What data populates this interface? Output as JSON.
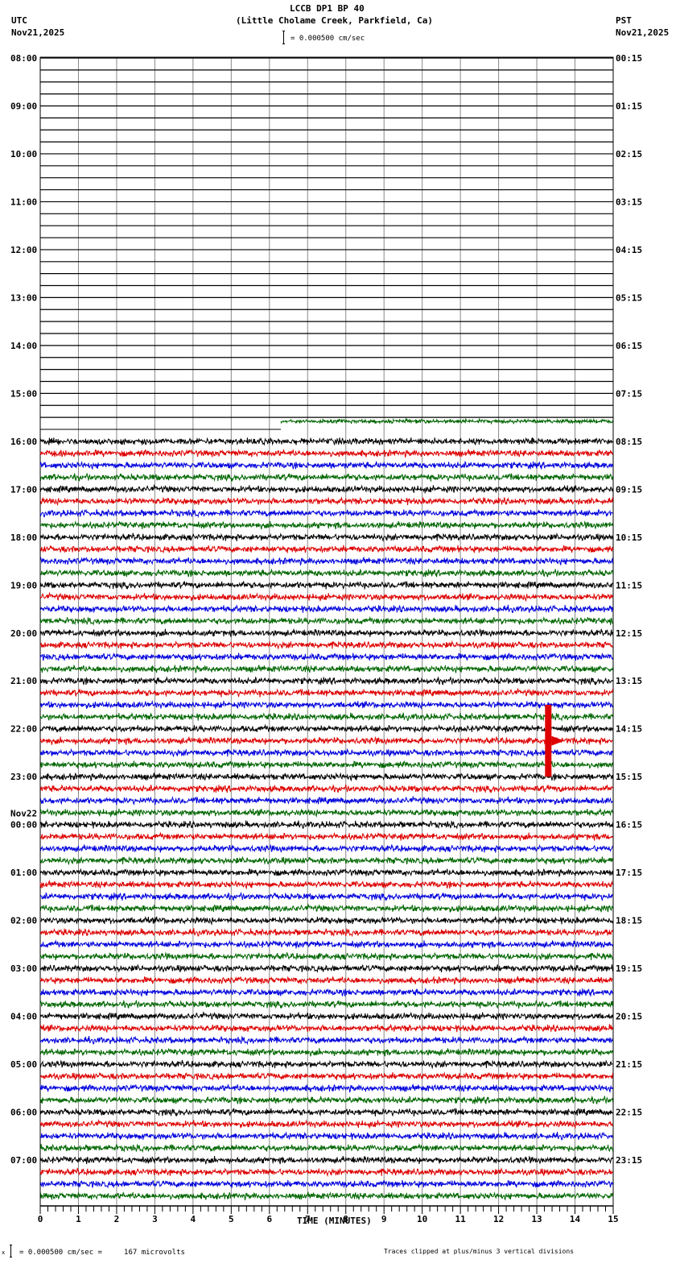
{
  "header": {
    "title": "LCCB DP1 BP 40",
    "subtitle": "(Little Cholame Creek, Parkfield, Ca)",
    "left_tz": "UTC",
    "left_date": "Nov21,2025",
    "right_tz": "PST",
    "right_date": "Nov21,2025",
    "scale_label": "= 0.000500 cm/sec"
  },
  "footer": {
    "scale_text": "= 0.000500 cm/sec =     167 microvolts",
    "scale_prefix": "x",
    "clip_note": "Traces clipped at plus/minus 3 vertical divisions"
  },
  "chart_data": {
    "type": "seismogram",
    "xlabel": "TIME (MINUTES)",
    "xlim": [
      0,
      15
    ],
    "x_ticks": [
      "0",
      "1",
      "2",
      "3",
      "4",
      "5",
      "6",
      "7",
      "8",
      "9",
      "10",
      "11",
      "12",
      "13",
      "14",
      "15"
    ],
    "rows_per_hour": 4,
    "trace_colors": [
      "#000000",
      "#dd0000",
      "#0000dd",
      "#006600"
    ],
    "utc_labels": [
      "08:00",
      "09:00",
      "10:00",
      "11:00",
      "12:00",
      "13:00",
      "14:00",
      "15:00",
      "16:00",
      "17:00",
      "18:00",
      "19:00",
      "20:00",
      "21:00",
      "22:00",
      "23:00",
      "00:00",
      "01:00",
      "02:00",
      "03:00",
      "04:00",
      "05:00",
      "06:00",
      "07:00"
    ],
    "pst_labels": [
      "00:15",
      "01:15",
      "02:15",
      "03:15",
      "04:15",
      "05:15",
      "06:15",
      "07:15",
      "08:15",
      "09:15",
      "10:15",
      "11:15",
      "12:15",
      "13:15",
      "14:15",
      "15:15",
      "16:15",
      "17:15",
      "18:15",
      "19:15",
      "20:15",
      "21:15",
      "22:15",
      "23:15"
    ],
    "date_change": {
      "label": "Nov22",
      "before_utc": "00:00"
    },
    "data_start": {
      "row": 31,
      "minute": 6.3
    },
    "events": [
      {
        "row": 57,
        "minute": 13.3,
        "note": "clipped"
      }
    ]
  }
}
